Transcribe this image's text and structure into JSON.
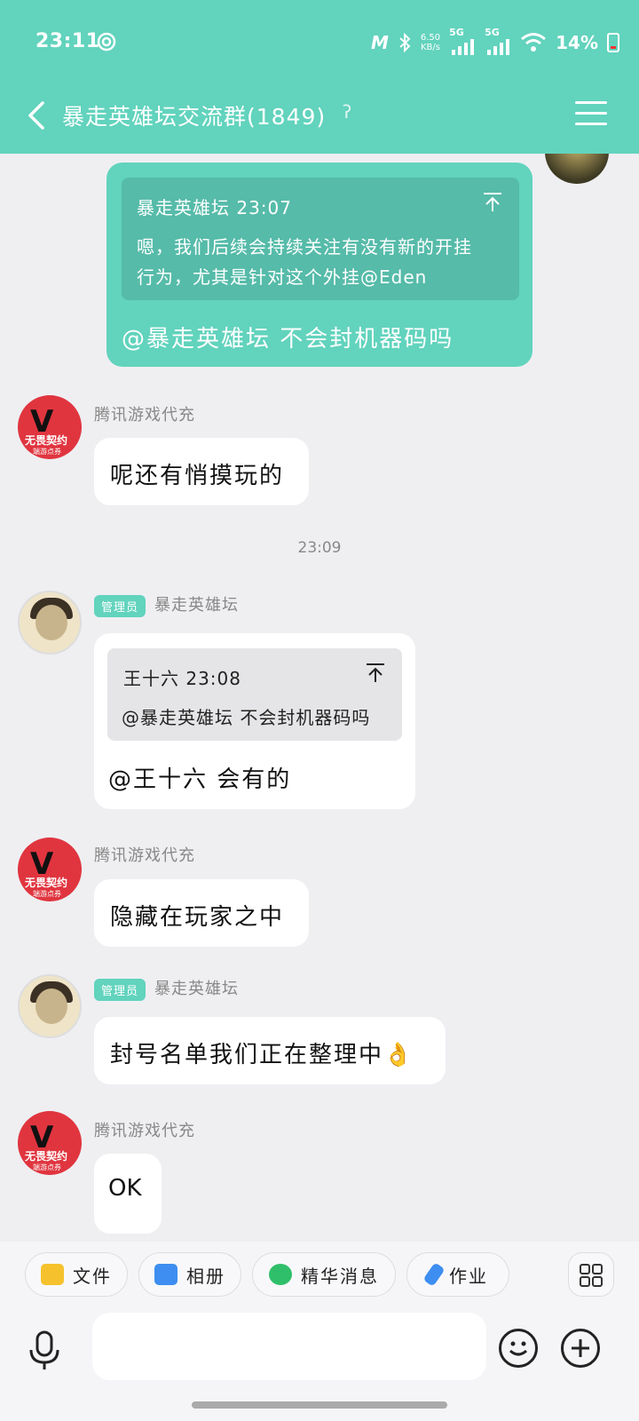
{
  "status_bar": {
    "time": "23:11",
    "speed_value": "6.50",
    "speed_unit": "KB/s",
    "net1": "5G",
    "net2": "5G",
    "battery_pct": "14%"
  },
  "header": {
    "title": "暴走英雄坛交流群(1849)"
  },
  "messages": {
    "m1": {
      "quote_head": "暴走英雄坛 23:07",
      "quote_line1": "嗯，我们后续会持续关注有没有新的开挂",
      "quote_line2": "行为，尤其是针对这个外挂@Eden",
      "text": "@暴走英雄坛 不会封机器码吗"
    },
    "m2": {
      "sender": "腾讯游戏代充",
      "text": "呢还有悄摸玩的"
    },
    "timestamp": "23:09",
    "m3": {
      "badge": "管理员",
      "sender": "暴走英雄坛",
      "quote_head": "王十六 23:08",
      "quote_text": "@暴走英雄坛 不会封机器码吗",
      "text": "@王十六 会有的"
    },
    "m4": {
      "sender": "腾讯游戏代充",
      "text": "隐藏在玩家之中"
    },
    "m5": {
      "badge": "管理员",
      "sender": "暴走英雄坛",
      "text": "封号名单我们正在整理中👌"
    },
    "m6": {
      "sender": "腾讯游戏代充",
      "text": "OK"
    }
  },
  "avatars": {
    "valorant_line1": "无畏契约",
    "valorant_line2": "端游点券"
  },
  "toolbar": {
    "file": "文件",
    "album": "相册",
    "essence": "精华消息",
    "homework": "作业"
  },
  "input": {
    "value": ""
  },
  "colors": {
    "accent": "#62d3bd",
    "avatar_red": "#e0353f",
    "bg": "#efeff2"
  }
}
